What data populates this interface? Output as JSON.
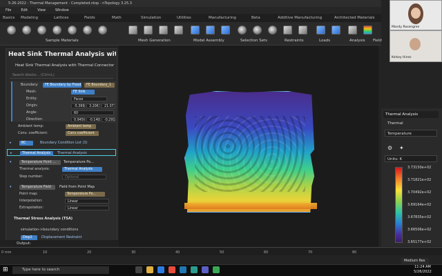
{
  "window": {
    "title": "5-26-2022 - Thermal Management - Completed.ntop - nTopology 3.25.3"
  },
  "menu": [
    "File",
    "Edit",
    "View",
    "Window"
  ],
  "ribbon_tabs": [
    "Basics",
    "Modeling",
    "Lattices",
    "Fields",
    "Math",
    "Simulation",
    "Utilities",
    "Manufacturing",
    "Beta",
    "Additive Manufacturing",
    "Architected Materials"
  ],
  "ribbon_groups": [
    "Sample Materials",
    "Mesh Generation",
    "Model Assembly",
    "Selection Sets",
    "Restraints",
    "Loads",
    "Analysis",
    "Field"
  ],
  "left_panel": {
    "title": "Heat Sink Thermal Analysis with Th...",
    "subtitle": "Heat Sink Thermal Analysis with Thermal Connector",
    "search_placeholder": "Search blocks... (Ctrl+L)",
    "boundary_label": "Boundary:",
    "boundary_chip": "FE Boundary by Flood...",
    "boundary_chip2": "FE Boundary_1",
    "mesh_label": "Mesh:",
    "mesh_value": "FE Sink",
    "entity_label": "Entity:",
    "entity_value": "Faces",
    "origin_label": "Origin:",
    "origin_x": "-5.369",
    "origin_y": "3.2067",
    "origin_z": "21.071",
    "origin_unit": "mm",
    "angle_label": "Angle:",
    "angle_value": "60",
    "angle_unit": "deg",
    "direction_label": "Direction:",
    "dir_x": "0.9456",
    "dir_y": "-0.1408",
    "dir_z": "-0.291",
    "ambient_label": "Ambient temp:",
    "ambient_value": "Ambient temp",
    "conv_label": "Conv. coefficient:",
    "conv_value": "Conv coefficient",
    "bc_tag": "BC",
    "bc_value": "Boundary Condition List (3)",
    "thermal_tag": "Thermal Analysis",
    "thermal_value": "Thermal Analysis",
    "tp_tag": "Temperature Point ...",
    "tp_value": "Temperature Po...",
    "ta_label": "Thermal analysis:",
    "ta_value": "Thermal Analysis",
    "step_label": "Step number:",
    "step_value": "Optional",
    "tf_tag": "Temperature Field",
    "tf_value": "Field from Point Map",
    "pm_label": "Point map:",
    "pm_value": "Temperature Po...",
    "interp_label": "Interpolation:",
    "interp_value": "Linear",
    "extrap_label": "Extrapolation:",
    "extrap_value": "Linear",
    "stress_title": "Thermal Stress Analysis (TSA)",
    "sim_note": "simulation->boundary conditions",
    "disp_tag": "Disp2",
    "disp_value": "Displacement Restraint",
    "output_label": "Output:"
  },
  "right_panel": {
    "title": "Thermal Analysis",
    "section": "Thermal",
    "field": "Temperature",
    "units": "Units: K",
    "colorbar_labels": [
      "3.73150e+02",
      "3.71821e+02",
      "3.70492e+02",
      "3.69164e+02",
      "3.67835e+02",
      "3.66506e+02",
      "3.65177e+02"
    ]
  },
  "ruler": {
    "unit": "0 mm",
    "ticks": [
      "10",
      "20",
      "30",
      "40",
      "50",
      "60",
      "70",
      "80"
    ]
  },
  "resolution": "Medium Res",
  "taskbar": {
    "search": "Type here to search",
    "time": "11:24 AM",
    "date": "5/26/2022"
  },
  "participants": [
    {
      "name": "Mandy Rosengren"
    },
    {
      "name": "Kelsey Hines"
    }
  ]
}
